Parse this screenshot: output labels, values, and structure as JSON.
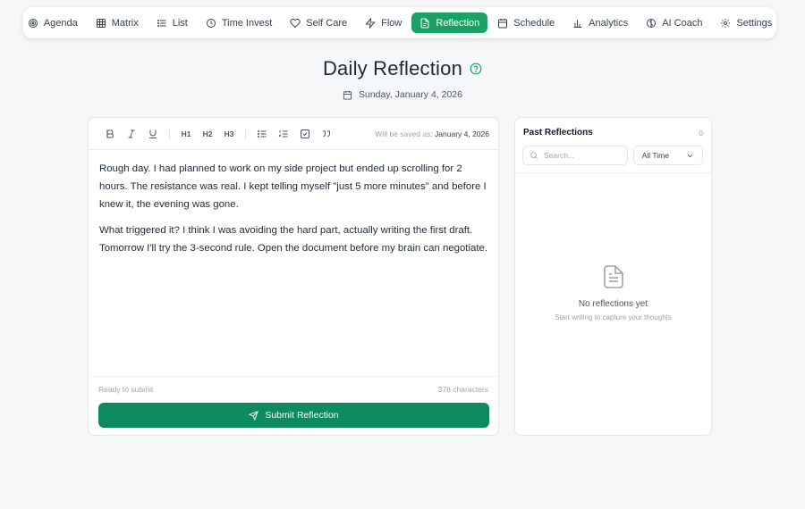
{
  "nav": {
    "items": [
      {
        "label": "Agenda",
        "icon": "target-icon",
        "active": false
      },
      {
        "label": "Matrix",
        "icon": "grid-icon",
        "active": false
      },
      {
        "label": "List",
        "icon": "list-icon",
        "active": false
      },
      {
        "label": "Time Invest",
        "icon": "clock-icon",
        "active": false
      },
      {
        "label": "Self Care",
        "icon": "heart-icon",
        "active": false
      },
      {
        "label": "Flow",
        "icon": "zap-icon",
        "active": false
      },
      {
        "label": "Reflection",
        "icon": "file-text-icon",
        "active": true
      },
      {
        "label": "Schedule",
        "icon": "calendar-icon",
        "active": false
      },
      {
        "label": "Analytics",
        "icon": "bar-chart-icon",
        "active": false
      },
      {
        "label": "AI Coach",
        "icon": "brain-icon",
        "active": false
      },
      {
        "label": "Settings",
        "icon": "gear-icon",
        "active": false
      }
    ]
  },
  "header": {
    "title": "Daily Reflection",
    "date": "Sunday, January 4, 2026"
  },
  "editor": {
    "toolbar": {
      "h1": "H1",
      "h2": "H2",
      "h3": "H3",
      "save_prefix": "Will be saved as:",
      "save_date": "January 4, 2026"
    },
    "paragraphs": [
      "Rough day. I had planned to work on my side project but ended up scrolling for 2 hours. The resistance was real. I kept telling myself \"just 5 more minutes\" and before I knew it, the evening was gone.",
      "What triggered it? I think I was avoiding the hard part, actually writing the first draft. Tomorrow I'll try the 3-second rule. Open the document before my brain can negotiate."
    ],
    "status": "Ready to submit",
    "char_count": "376 characters",
    "submit_label": "Submit Reflection"
  },
  "past": {
    "title": "Past Reflections",
    "count": "0",
    "search_placeholder": "Search...",
    "filter_value": "All Time",
    "empty_title": "No reflections yet",
    "empty_subtitle": "Start writing to capture your thoughts"
  },
  "colors": {
    "accent": "#1aa265",
    "submit": "#0e8a5f",
    "background": "#f5f7f9"
  }
}
